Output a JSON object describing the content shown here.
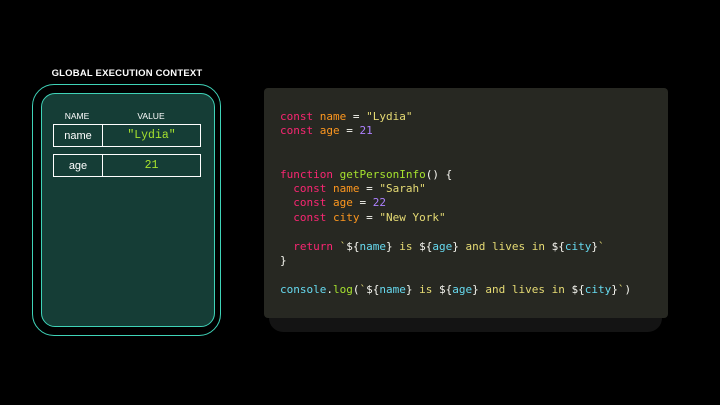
{
  "context": {
    "title": "GLOBAL EXECUTION CONTEXT",
    "headers": {
      "name": "NAME",
      "value": "VALUE"
    },
    "rows": [
      {
        "name": "name",
        "value": "\"Lydia\""
      },
      {
        "name": "age",
        "value": "21"
      }
    ]
  },
  "code": {
    "lines": [
      [
        {
          "t": "const ",
          "c": "kw"
        },
        {
          "t": "name",
          "c": "var"
        },
        {
          "t": " = ",
          "c": "plain"
        },
        {
          "t": "\"Lydia\"",
          "c": "str"
        }
      ],
      [
        {
          "t": "const ",
          "c": "kw"
        },
        {
          "t": "age",
          "c": "var"
        },
        {
          "t": " = ",
          "c": "plain"
        },
        {
          "t": "21",
          "c": "num"
        }
      ],
      [],
      [],
      [
        {
          "t": "function ",
          "c": "kw"
        },
        {
          "t": "getPersonInfo",
          "c": "fn"
        },
        {
          "t": "() {",
          "c": "plain"
        }
      ],
      [
        {
          "t": "  const ",
          "c": "kw"
        },
        {
          "t": "name",
          "c": "var"
        },
        {
          "t": " = ",
          "c": "plain"
        },
        {
          "t": "\"Sarah\"",
          "c": "str"
        }
      ],
      [
        {
          "t": "  const ",
          "c": "kw"
        },
        {
          "t": "age",
          "c": "var"
        },
        {
          "t": " = ",
          "c": "plain"
        },
        {
          "t": "22",
          "c": "num"
        }
      ],
      [
        {
          "t": "  const ",
          "c": "kw"
        },
        {
          "t": "city",
          "c": "var"
        },
        {
          "t": " = ",
          "c": "plain"
        },
        {
          "t": "\"New York\"",
          "c": "str"
        }
      ],
      [],
      [
        {
          "t": "  return ",
          "c": "kw"
        },
        {
          "t": "`",
          "c": "str"
        },
        {
          "t": "${",
          "c": "plain"
        },
        {
          "t": "name",
          "c": "interp"
        },
        {
          "t": "}",
          "c": "plain"
        },
        {
          "t": " is ",
          "c": "str"
        },
        {
          "t": "${",
          "c": "plain"
        },
        {
          "t": "age",
          "c": "interp"
        },
        {
          "t": "}",
          "c": "plain"
        },
        {
          "t": " and lives in ",
          "c": "str"
        },
        {
          "t": "${",
          "c": "plain"
        },
        {
          "t": "city",
          "c": "interp"
        },
        {
          "t": "}",
          "c": "plain"
        },
        {
          "t": "`",
          "c": "str"
        }
      ],
      [
        {
          "t": "}",
          "c": "plain"
        }
      ],
      [],
      [
        {
          "t": "console",
          "c": "interp"
        },
        {
          "t": ".",
          "c": "plain"
        },
        {
          "t": "log",
          "c": "fn"
        },
        {
          "t": "(",
          "c": "plain"
        },
        {
          "t": "`",
          "c": "str"
        },
        {
          "t": "${",
          "c": "plain"
        },
        {
          "t": "name",
          "c": "interp"
        },
        {
          "t": "}",
          "c": "plain"
        },
        {
          "t": " is ",
          "c": "str"
        },
        {
          "t": "${",
          "c": "plain"
        },
        {
          "t": "age",
          "c": "interp"
        },
        {
          "t": "}",
          "c": "plain"
        },
        {
          "t": " and lives in ",
          "c": "str"
        },
        {
          "t": "${",
          "c": "plain"
        },
        {
          "t": "city",
          "c": "interp"
        },
        {
          "t": "}",
          "c": "plain"
        },
        {
          "t": "`",
          "c": "str"
        },
        {
          "t": ")",
          "c": "plain"
        }
      ]
    ]
  },
  "colors": {
    "background": "#000000",
    "context_border": "#3fd3b8",
    "context_fill": "#153d36",
    "code_background": "#272822",
    "keyword": "#f92672",
    "variable": "#fd971f",
    "string": "#e6db74",
    "number": "#ae81ff",
    "function": "#a6e22e",
    "interpolation": "#66d9ef"
  }
}
